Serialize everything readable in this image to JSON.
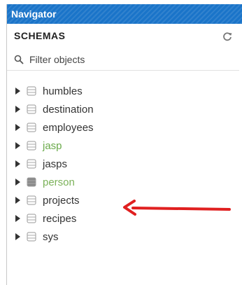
{
  "navigator": {
    "title": "Navigator"
  },
  "schemas": {
    "header": "SCHEMAS",
    "refresh_icon": "refresh-icon"
  },
  "filter": {
    "placeholder": "Filter objects",
    "value": ""
  },
  "tree": {
    "items": [
      {
        "label": "humbles",
        "color": "#333333",
        "icon_fill": "#ffffff"
      },
      {
        "label": "destination",
        "color": "#333333",
        "icon_fill": "#ffffff"
      },
      {
        "label": "employees",
        "color": "#333333",
        "icon_fill": "#ffffff"
      },
      {
        "label": "jasp",
        "color": "#6aaa4a",
        "icon_fill": "#ffffff"
      },
      {
        "label": "jasps",
        "color": "#333333",
        "icon_fill": "#ffffff"
      },
      {
        "label": "person",
        "color": "#7cb25a",
        "icon_fill": "#8a8a8a"
      },
      {
        "label": "projects",
        "color": "#333333",
        "icon_fill": "#ffffff"
      },
      {
        "label": "recipes",
        "color": "#333333",
        "icon_fill": "#ffffff"
      },
      {
        "label": "sys",
        "color": "#333333",
        "icon_fill": "#ffffff"
      }
    ]
  },
  "annotation": {
    "arrow_color": "#e02020",
    "points_to": "projects"
  },
  "colors": {
    "titlebar": "#1a74c9"
  }
}
